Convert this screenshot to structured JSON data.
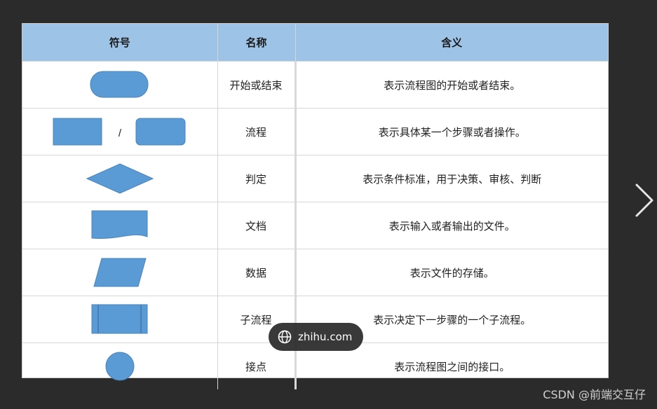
{
  "table": {
    "headers": {
      "symbol": "符号",
      "name": "名称",
      "meaning": "含义"
    },
    "rows": [
      {
        "symbol_icon": "terminator-shape",
        "name": "开始或结束",
        "meaning": "表示流程图的开始或者结束。"
      },
      {
        "symbol_icon": "process-shape",
        "separator": "/",
        "name": "流程",
        "meaning": "表示具体某一个步骤或者操作。"
      },
      {
        "symbol_icon": "decision-shape",
        "name": "判定",
        "meaning": "表示条件标准，用于决策、审核、判断"
      },
      {
        "symbol_icon": "document-shape",
        "name": "文档",
        "meaning": "表示输入或者输出的文件。"
      },
      {
        "symbol_icon": "data-shape",
        "name": "数据",
        "meaning": "表示文件的存储。"
      },
      {
        "symbol_icon": "subprocess-shape",
        "name": "子流程",
        "meaning": "表示决定下一步骤的一个子流程。"
      },
      {
        "symbol_icon": "connector-shape",
        "name": "接点",
        "meaning": "表示流程图之间的接口。"
      }
    ]
  },
  "colors": {
    "header_bg": "#9dc3e6",
    "shape_fill": "#5b9bd5",
    "shape_stroke": "#4a84bb",
    "viewer_bg": "#2b2b2b"
  },
  "watermark": {
    "icon": "globe-icon",
    "text": "zhihu.com"
  },
  "credit": "CSDN @前端交互仔",
  "navigation": {
    "next_icon": "chevron-right-icon"
  }
}
